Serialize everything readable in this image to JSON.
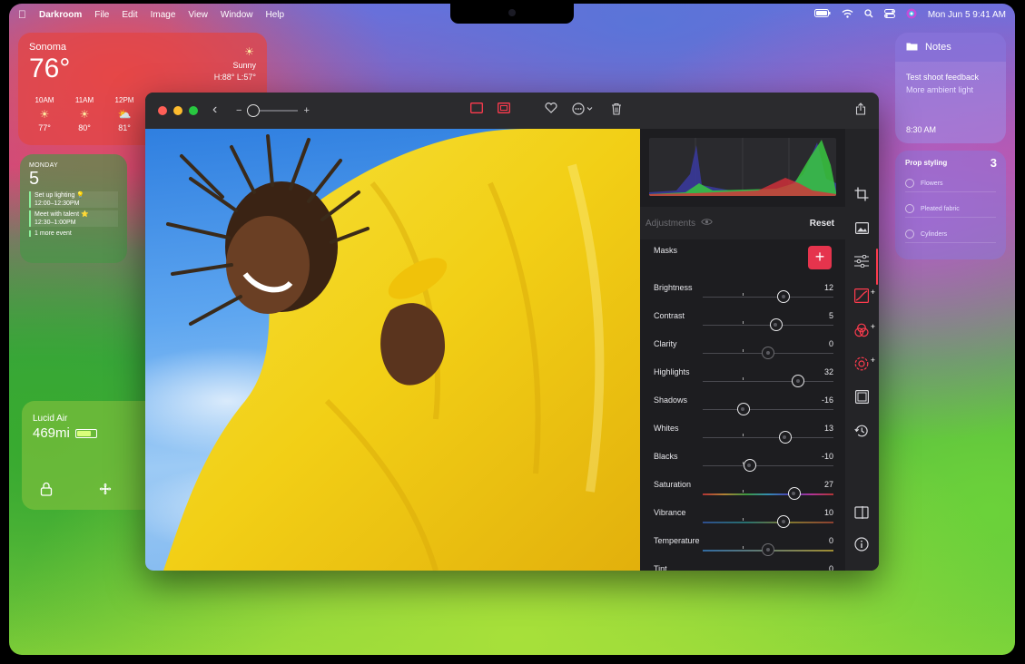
{
  "menubar": {
    "app": "Darkroom",
    "menus": [
      "File",
      "Edit",
      "Image",
      "View",
      "Window",
      "Help"
    ],
    "datetime": "Mon Jun 5  9:41 AM"
  },
  "weather": {
    "city": "Sonoma",
    "temp": "76°",
    "condition": "Sunny",
    "range": "H:88° L:57°",
    "hours": [
      {
        "time": "10AM",
        "icon": "sun-icon",
        "temp": "77°"
      },
      {
        "time": "11AM",
        "icon": "sun-icon",
        "temp": "80°"
      },
      {
        "time": "12PM",
        "icon": "partly-cloudy-icon",
        "temp": "81°"
      }
    ]
  },
  "calendar": {
    "month": "MONDAY",
    "day": "5",
    "events": [
      {
        "title": "Set up lighting 💡",
        "time": "12:00–12:30PM"
      },
      {
        "title": "Meet with talent ⭐",
        "time": "12:30–1:00PM"
      }
    ],
    "more": "1 more event"
  },
  "car": {
    "name": "Lucid Air",
    "range": "469mi",
    "battery": 0.85
  },
  "notes": {
    "header": "Notes",
    "title": "Test shoot feedback",
    "subtitle": "More ambient light",
    "time": "8:30 AM"
  },
  "reminders": {
    "title": "Prop styling",
    "count": "3",
    "items": [
      "Flowers",
      "Pleated fabric",
      "Cylinders"
    ]
  },
  "panel": {
    "adjustments_label": "Adjustments",
    "reset_label": "Reset",
    "masks_label": "Masks",
    "add_mask": "+",
    "sliders": [
      {
        "name": "brightness",
        "label": "Brightness",
        "value": "12",
        "pos": 0.62
      },
      {
        "name": "contrast",
        "label": "Contrast",
        "value": "5",
        "pos": 0.56
      },
      {
        "name": "clarity",
        "label": "Clarity",
        "value": "0",
        "pos": 0.5
      },
      {
        "name": "highlights",
        "label": "Highlights",
        "value": "32",
        "pos": 0.73
      },
      {
        "name": "shadows",
        "label": "Shadows",
        "value": "-16",
        "pos": 0.31
      },
      {
        "name": "whites",
        "label": "Whites",
        "value": "13",
        "pos": 0.63
      },
      {
        "name": "blacks",
        "label": "Blacks",
        "value": "-10",
        "pos": 0.36
      },
      {
        "name": "saturation",
        "label": "Saturation",
        "value": "27",
        "pos": 0.7
      },
      {
        "name": "vibrance",
        "label": "Vibrance",
        "value": "10",
        "pos": 0.62
      },
      {
        "name": "temperature",
        "label": "Temperature",
        "value": "0",
        "pos": 0.5
      },
      {
        "name": "tint",
        "label": "Tint",
        "value": "0",
        "pos": 0.5
      }
    ]
  },
  "colors": {
    "accent": "#ff3b4e",
    "traffic_close": "#ff5f57",
    "traffic_min": "#febc2e",
    "traffic_max": "#28c840"
  }
}
